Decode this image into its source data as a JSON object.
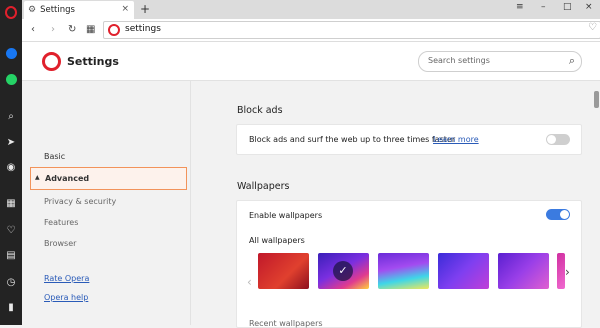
{
  "browser": {
    "tab_title": "Settings",
    "tab_close": "×",
    "new_tab": "+",
    "address": "settings",
    "icons": {
      "back": "‹",
      "forward": "›",
      "reload": "↻",
      "speed_dial": "▦",
      "heart": "♡",
      "menu": "≡",
      "minimize": "–",
      "maximize": "□",
      "close": "×"
    }
  },
  "rail_icons": [
    "O",
    "m",
    "✆",
    "⌕",
    "➤",
    "◉",
    "▦",
    "♡",
    "▤",
    "◷",
    "▮"
  ],
  "settings": {
    "title": "Settings",
    "search_placeholder": "Search settings",
    "search_icon": "⌕",
    "sidebar": {
      "basic": "Basic",
      "advanced": "Advanced",
      "advanced_arrow": "▲",
      "privacy": "Privacy & security",
      "features": "Features",
      "browser": "Browser",
      "rate": "Rate Opera",
      "help": "Opera help"
    },
    "block_ads": {
      "heading": "Block ads",
      "text": "Block ads and surf the web up to three times faster",
      "learn_more": "Learn more",
      "enabled": false
    },
    "wallpapers": {
      "heading": "Wallpapers",
      "enable_label": "Enable wallpapers",
      "enabled": true,
      "all_label": "All wallpapers",
      "recent_label": "Recent wallpapers",
      "check": "✓",
      "prev": "‹",
      "next": "›"
    }
  },
  "colors": {
    "accent": "#3b7be0",
    "opera_red": "#e0202c",
    "link": "#2a5bb8",
    "advanced_border": "#f2935a"
  }
}
